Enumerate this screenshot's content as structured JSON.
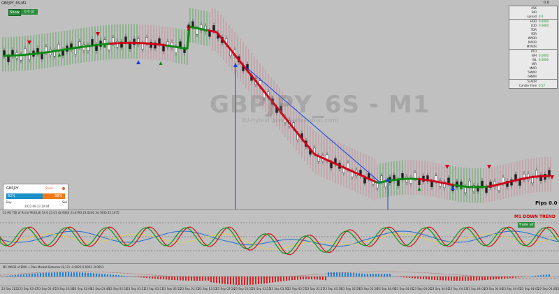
{
  "chart": {
    "symbol_title": "GBPJPY_6S,M1",
    "watermark": "GBPJPY_6S - M1",
    "watermark_sub": "XU-Hybrid (www.tradestation.com)",
    "top_price": "0.0",
    "pips_label": "Pips 0.0",
    "colors": {
      "up": "#0a8a12",
      "down": "#d00018",
      "cloud_up": "#3c9a3c",
      "cloud_down": "#c87c8a",
      "arrow_blue": "#1440e0"
    }
  },
  "toolbar": {
    "show_label": "Show",
    "pnl_label": "0.0 pt"
  },
  "info_panel": {
    "rows": [
      {
        "k": "ASK",
        "v": ""
      },
      {
        "k": "BID",
        "v": ""
      },
      {
        "k": "spread",
        "v": "0.0"
      },
      {
        "k": "HOD",
        "v": "0.0000"
      },
      {
        "k": "LOD",
        "v": "0.0000"
      },
      {
        "k": "TDR",
        "v": ""
      },
      {
        "k": "YDR",
        "v": ""
      },
      {
        "k": "WADR",
        "v": ""
      },
      {
        "k": "MADR",
        "v": ""
      },
      {
        "k": "MYADR",
        "v": ""
      },
      {
        "k": "PTO",
        "v": ""
      },
      {
        "k": "WH",
        "v": "0.0000"
      },
      {
        "k": "WL",
        "v": "0.0000"
      },
      {
        "k": "WR",
        "v": ""
      },
      {
        "k": "MWR",
        "v": ""
      },
      {
        "k": "5MWR",
        "v": ""
      },
      {
        "k": "6MWR",
        "v": ""
      },
      {
        "k": "5xADR",
        "v": ""
      },
      {
        "k": "Candle Time",
        "v": "0:57"
      }
    ]
  },
  "sentiment_widget": {
    "symbol": "GBPJPY",
    "status": "Short",
    "buy_pct": "62%",
    "sell_pct": "38%",
    "buy_fraction": 0.62,
    "buy_label": "Buy",
    "sell_label": "Sell",
    "date": "2022.09.23 10:04"
  },
  "rsi_pane": {
    "title": "22 M1 TDI of Rsi of M(24,8) 54.6 23.41 42.9344 23.4793 23.0246 34.7835 45.1675",
    "trend_label": "M1 DOWN TREND",
    "trade_label": "Trade all"
  },
  "macd_pane": {
    "title": "M1 MACD of EMA + Plan Market Detector (8,12) -0.0022 0.0053 -0.0053"
  },
  "time_axis": [
    "23 Sep 2022",
    "23 Sep 03:47",
    "23 Sep 03:47",
    "23 Sep 03:48",
    "23 Sep 03:49",
    "23 Sep 03:49",
    "23 Sep 03:50",
    "23 Sep 03:51",
    "23 Sep 03:51",
    "23 Sep 03:52",
    "23 Sep 03:53",
    "23 Sep 03:53",
    "23 Sep 03:54",
    "23 Sep 03:55",
    "23 Sep 03:55",
    "23 Sep 03:56",
    "23 Sep 03:57",
    "23 Sep 03:57",
    "23 Sep 03:58",
    "23 Sep 03:59",
    "23 Sep 03:59",
    "23 Sep 04:00",
    "23 Sep 04:01",
    "23 Sep 04:01",
    "23 Sep 04:02",
    "23 Sep 04:03",
    "23 Sep 04:03",
    "23 Sep 04:04",
    "23 Sep 04:05",
    "23 Sep 04:05",
    "23 Sep 04:06",
    "23 Se"
  ]
}
